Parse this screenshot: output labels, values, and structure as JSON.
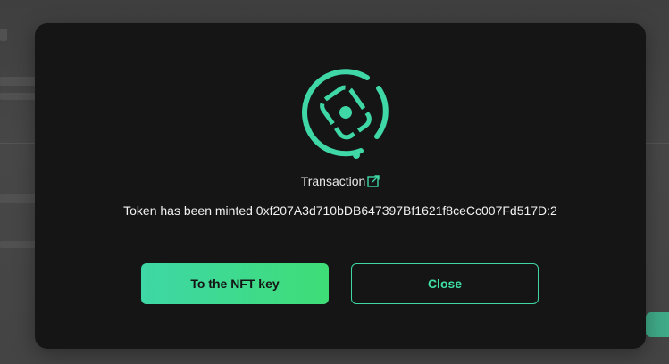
{
  "modal": {
    "transaction_label": "Transaction",
    "message": "Token has been minted 0xf207A3d710bDB647397Bf1621f8ceCc007Fd517D:2",
    "primary_button": "To the NFT key",
    "secondary_button": "Close"
  },
  "icons": {
    "logo": "nft-key-logo-icon",
    "external_link": "external-link-icon"
  },
  "colors": {
    "accent": "#3fd7a5",
    "modal_background": "#151515",
    "text": "#f2f2f2"
  }
}
